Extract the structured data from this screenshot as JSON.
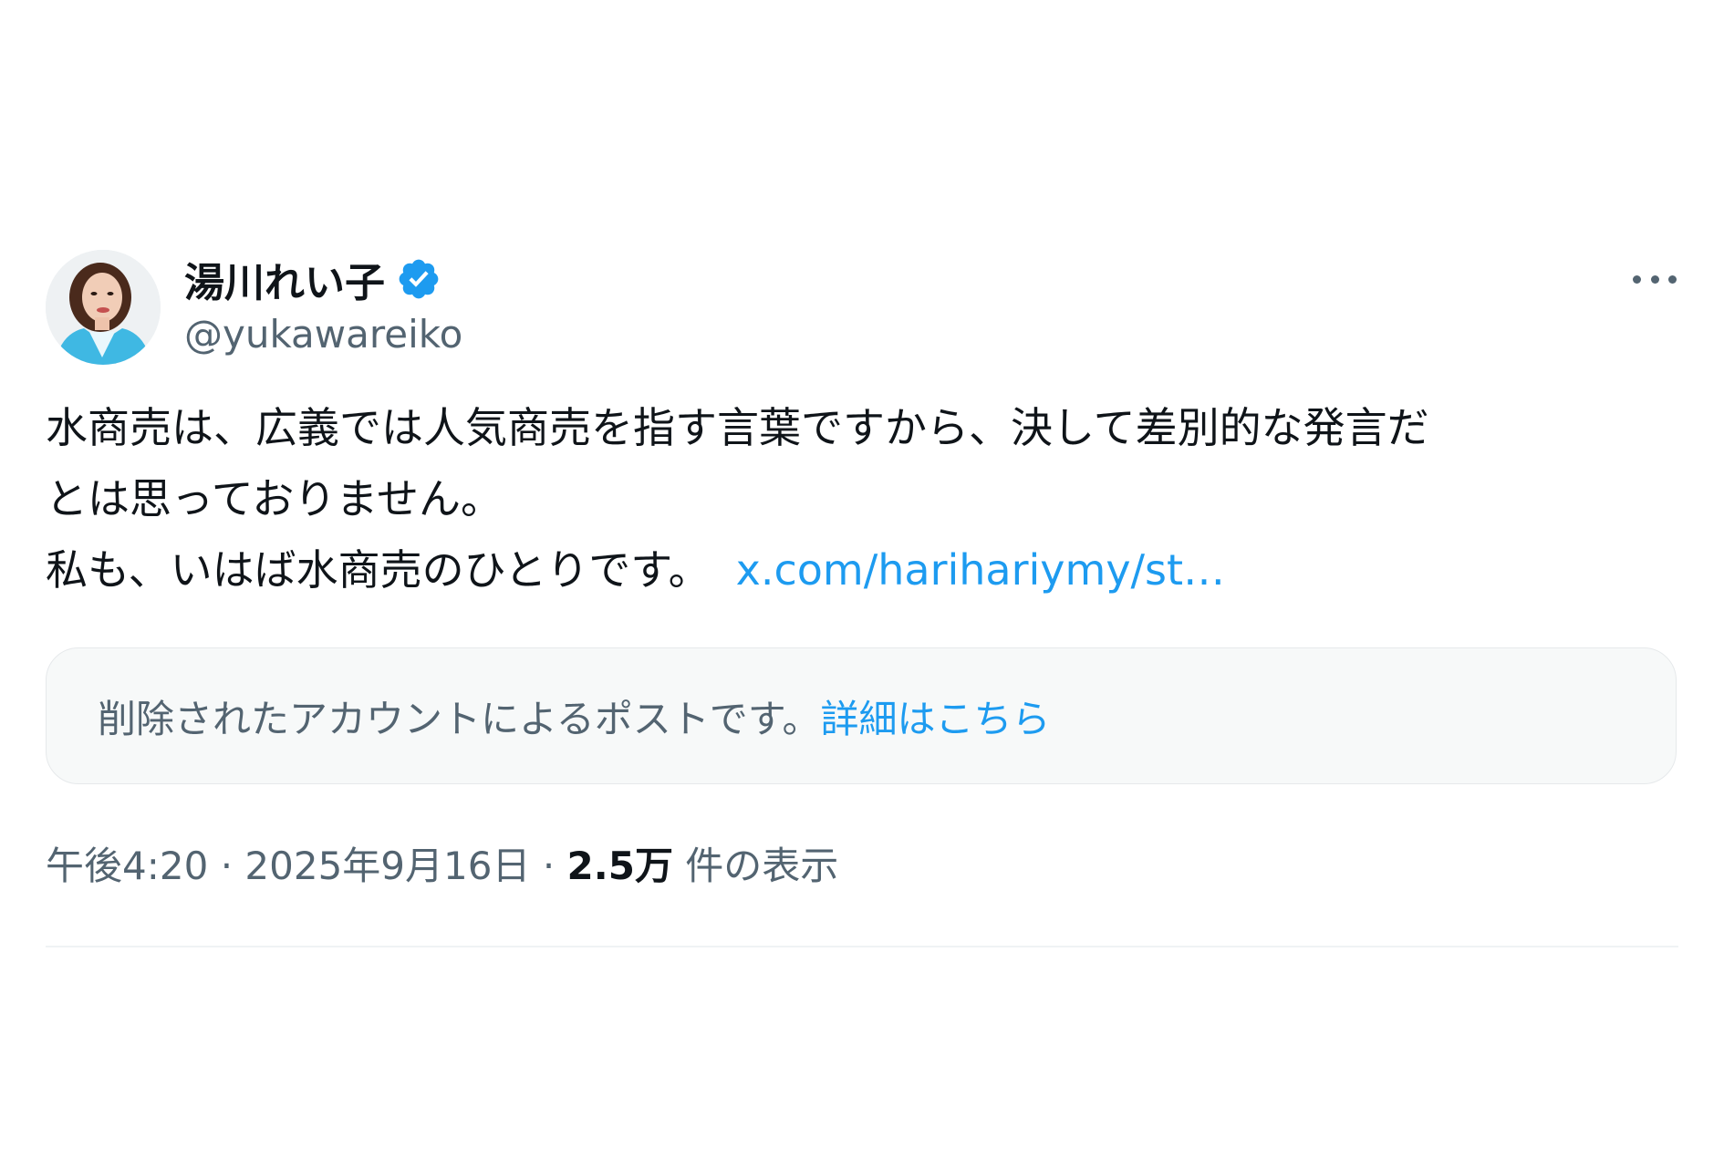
{
  "author": {
    "display_name": "湯川れい子",
    "handle": "@yukawareiko",
    "verified_icon": "verified-badge-icon",
    "avatar": "profile-photo"
  },
  "menu": {
    "icon": "more-horizontal-icon"
  },
  "post": {
    "line1": "水商売は、広義では人気商売を指す言葉ですから、決して差別的な発言だ",
    "line2": "とは思っておりません。",
    "line3": "私も、いはば水商売のひとりです。",
    "link": "x.com/harihariymy/st…"
  },
  "quoted": {
    "text": "削除されたアカウントによるポストです。",
    "link": "詳細はこちら"
  },
  "meta": {
    "time": "午後4:20",
    "separator": "·",
    "date": "2025年9月16日",
    "views_count": "2.5万",
    "views_label": " 件の表示"
  },
  "colors": {
    "accent": "#1d9bf0",
    "secondary_text": "#536471",
    "primary_text": "#0f1419",
    "quote_bg": "#f7f9f9"
  }
}
